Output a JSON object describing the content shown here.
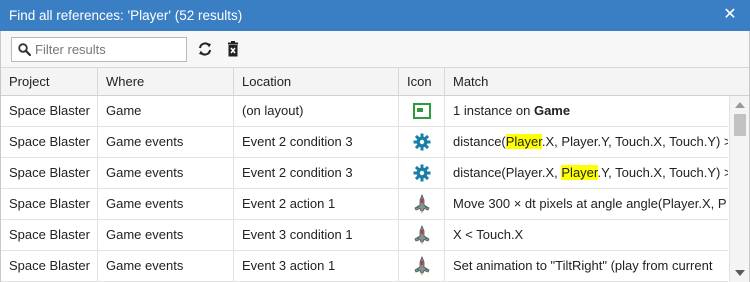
{
  "window": {
    "title": "Find all references: 'Player' (52 results)"
  },
  "toolbar": {
    "filter_placeholder": "Filter results"
  },
  "columns": {
    "project": "Project",
    "where": "Where",
    "location": "Location",
    "icon": "Icon",
    "match": "Match"
  },
  "rows": [
    {
      "project": "Space Blaster",
      "where": "Game",
      "location": "(on layout)",
      "icon": "layout-icon",
      "match": {
        "a": "1 instance on ",
        "hl": "",
        "b": "Game",
        "bold": true
      }
    },
    {
      "project": "Space Blaster",
      "where": "Game events",
      "location": "Event 2 condition 3",
      "icon": "gear-icon",
      "match": {
        "a": "distance(",
        "hl": "Player",
        "b": ".X, Player.Y, Touch.X, Touch.Y) >",
        "bold": false
      }
    },
    {
      "project": "Space Blaster",
      "where": "Game events",
      "location": "Event 2 condition 3",
      "icon": "gear-icon",
      "match": {
        "a": "distance(Player.X, ",
        "hl": "Player",
        "b": ".Y, Touch.X, Touch.Y) >",
        "bold": false
      }
    },
    {
      "project": "Space Blaster",
      "where": "Game events",
      "location": "Event 2 action 1",
      "icon": "ship-sprite-icon",
      "match": {
        "a": "Move 300 × dt pixels at angle angle(Player.X, P",
        "hl": "",
        "b": "",
        "bold": false
      }
    },
    {
      "project": "Space Blaster",
      "where": "Game events",
      "location": "Event 3 condition 1",
      "icon": "ship-sprite-icon",
      "match": {
        "a": "X < Touch.X",
        "hl": "",
        "b": "",
        "bold": false
      }
    },
    {
      "project": "Space Blaster",
      "where": "Game events",
      "location": "Event 3 action 1",
      "icon": "ship-sprite-icon",
      "match": {
        "a": "Set animation to \"TiltRight\" (play from current",
        "hl": "",
        "b": "",
        "bold": false
      }
    }
  ],
  "colors": {
    "titlebar": "#3a7fc4",
    "highlight": "#ffff00",
    "gear": "#1a7fa8",
    "layout": "#2e9b3c"
  }
}
